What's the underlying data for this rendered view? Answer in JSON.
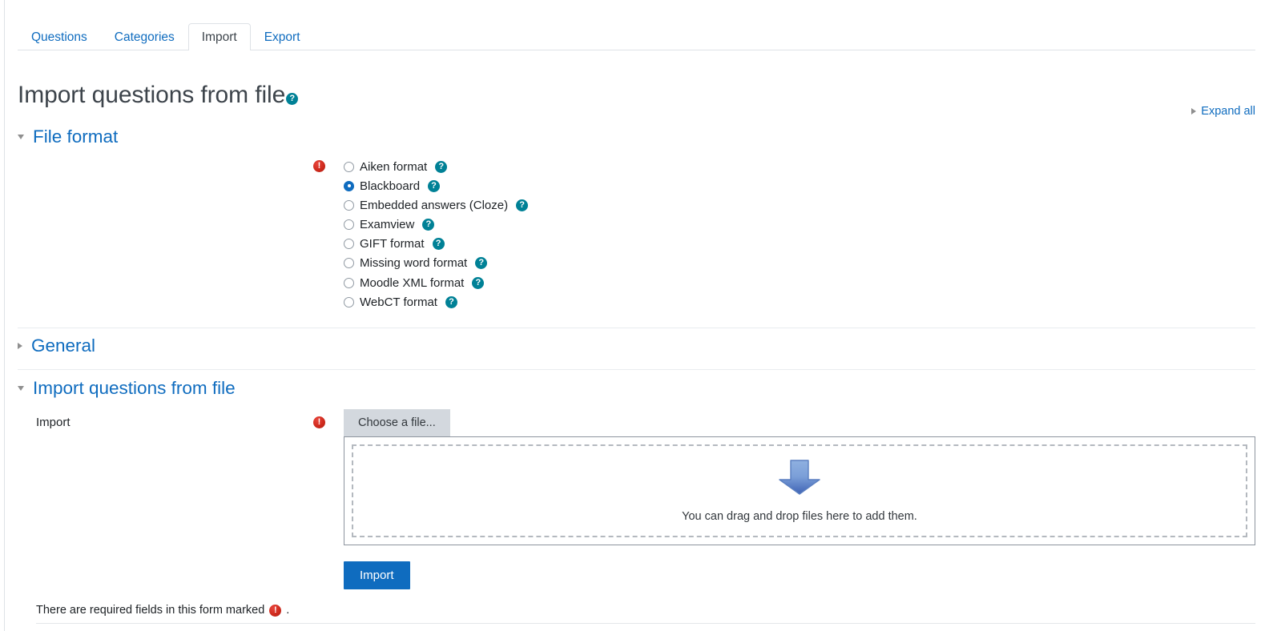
{
  "tabs": [
    {
      "label": "Questions",
      "active": false
    },
    {
      "label": "Categories",
      "active": false
    },
    {
      "label": "Import",
      "active": true
    },
    {
      "label": "Export",
      "active": false
    }
  ],
  "page": {
    "title": "Import questions from file",
    "help_icon": "help-icon",
    "expand_all": "Expand all",
    "required_note_prefix": "There are required fields in this form marked",
    "required_note_suffix": ".",
    "required_icon": "required-icon"
  },
  "sections": {
    "file_format": {
      "title": "File format",
      "expanded": true,
      "toggle_icon": "chevron-down-icon"
    },
    "general": {
      "title": "General",
      "expanded": false,
      "toggle_icon": "chevron-right-icon"
    },
    "import_from_file": {
      "title": "Import questions from file",
      "expanded": true,
      "toggle_icon": "chevron-down-icon"
    }
  },
  "file_format_options": [
    {
      "label": "Aiken format",
      "checked": false
    },
    {
      "label": "Blackboard",
      "checked": true
    },
    {
      "label": "Embedded answers (Cloze)",
      "checked": false
    },
    {
      "label": "Examview",
      "checked": false
    },
    {
      "label": "GIFT format",
      "checked": false
    },
    {
      "label": "Missing word format",
      "checked": false
    },
    {
      "label": "Moodle XML format",
      "checked": false
    },
    {
      "label": "WebCT format",
      "checked": false
    }
  ],
  "import_field": {
    "label": "Import",
    "choose_file_button": "Choose a file...",
    "dropzone_text": "You can drag and drop files here to add them.",
    "drop_arrow_icon": "down-arrow-icon"
  },
  "submit": {
    "label": "Import"
  },
  "colors": {
    "link": "#0f6cbf",
    "primary_button": "#0f6cbf",
    "help_icon": "#008196",
    "required_icon": "#cf2a1d",
    "active_tab_text": "#3d444b",
    "toolbar_grey": "#d3d8de"
  }
}
